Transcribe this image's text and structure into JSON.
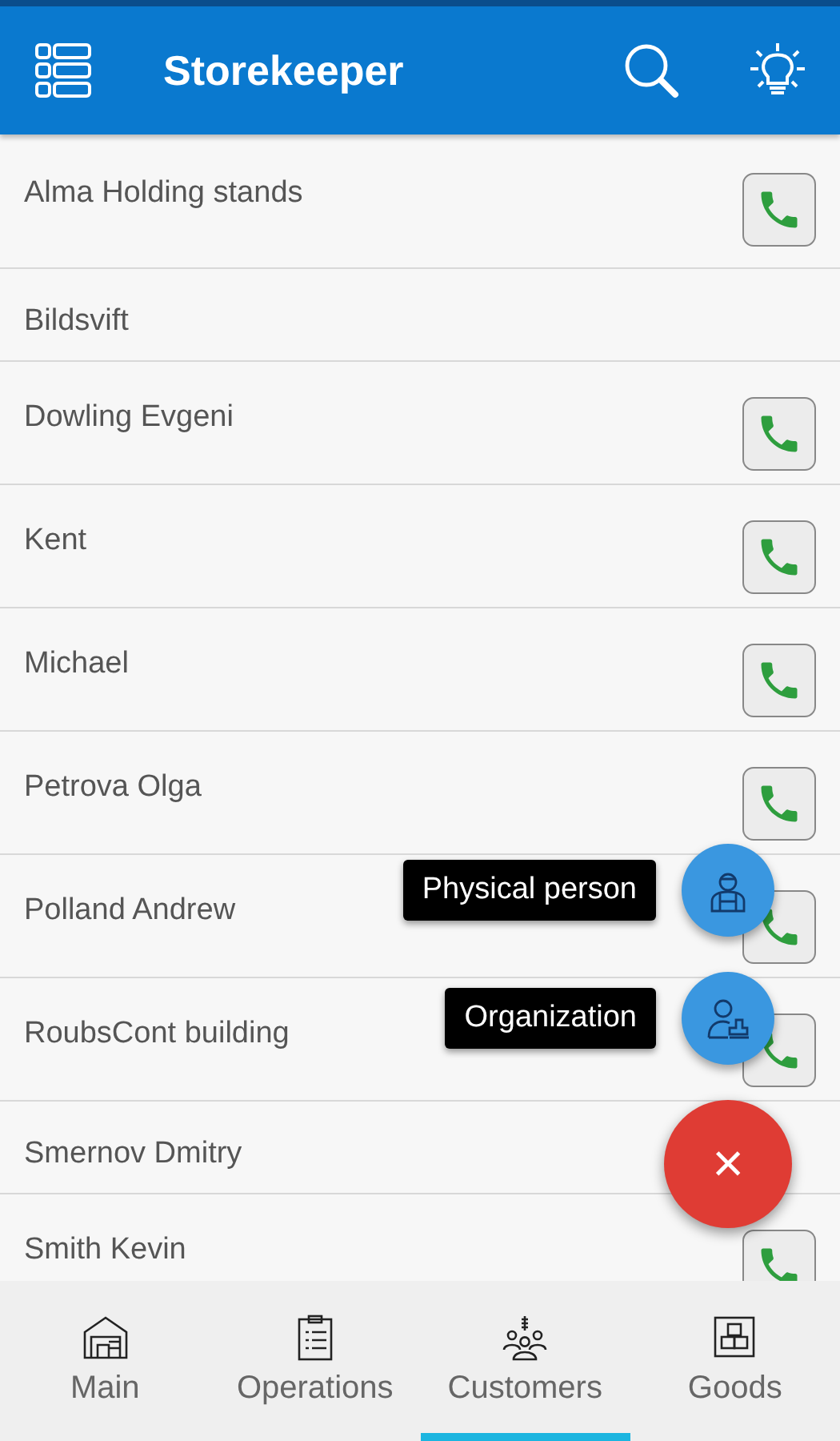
{
  "app_bar": {
    "title": "Storekeeper"
  },
  "customers": [
    {
      "name": "Alma Holding stands",
      "has_phone": true
    },
    {
      "name": "Bildsvift",
      "has_phone": false
    },
    {
      "name": "Dowling Evgeni",
      "has_phone": true
    },
    {
      "name": "Kent",
      "has_phone": true
    },
    {
      "name": "Michael",
      "has_phone": true
    },
    {
      "name": "Petrova Olga",
      "has_phone": true
    },
    {
      "name": "Polland Andrew",
      "has_phone": true
    },
    {
      "name": "RoubsCont building",
      "has_phone": true
    },
    {
      "name": "Smernov Dmitry",
      "has_phone": false
    },
    {
      "name": "Smith Kevin",
      "has_phone": true
    }
  ],
  "fab_menu": {
    "items": [
      {
        "label": "Physical person",
        "kind": "person"
      },
      {
        "label": "Organization",
        "kind": "organization"
      }
    ],
    "close": "×"
  },
  "bottom_nav": [
    {
      "label": "Main",
      "kind": "warehouse",
      "selected": false
    },
    {
      "label": "Operations",
      "kind": "clipboard",
      "selected": false
    },
    {
      "label": "Customers",
      "kind": "customers",
      "selected": true
    },
    {
      "label": "Goods",
      "kind": "boxes",
      "selected": false
    }
  ]
}
